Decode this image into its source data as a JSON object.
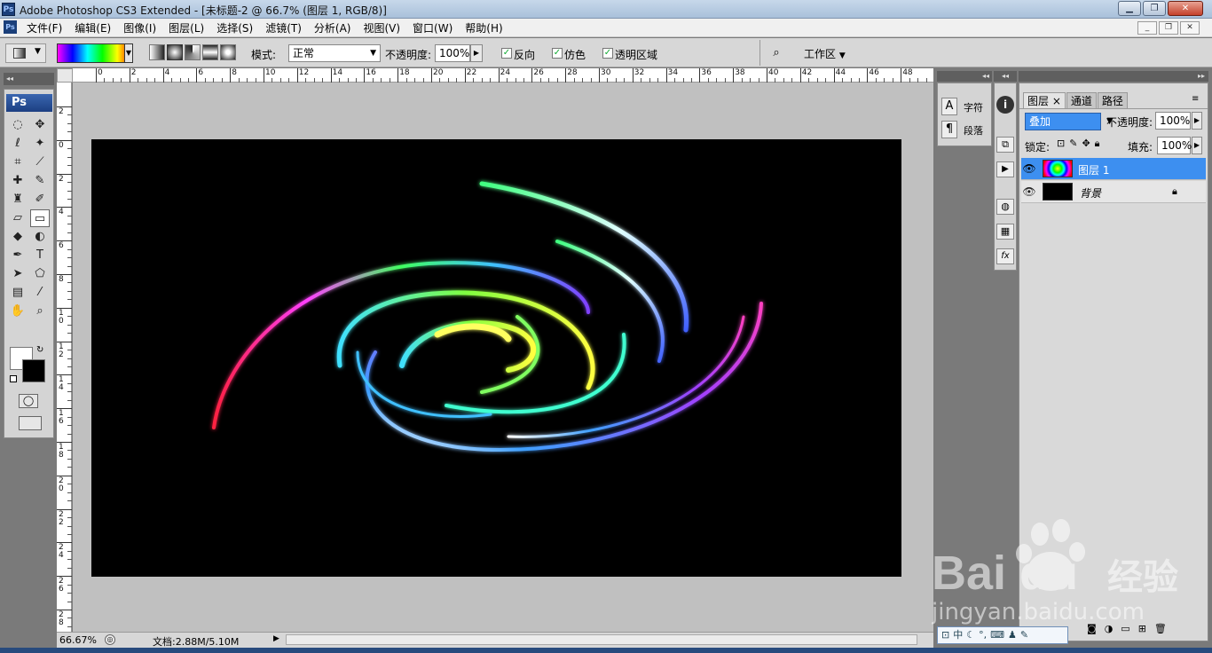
{
  "window": {
    "title": "Adobe Photoshop CS3 Extended - [未标题-2 @ 66.7% (图层 1, RGB/8)]",
    "app_icon": "Ps",
    "controls": [
      "minimize-icon",
      "maximize-icon",
      "close-icon"
    ]
  },
  "menubar": {
    "items": [
      "文件(F)",
      "编辑(E)",
      "图像(I)",
      "图层(L)",
      "选择(S)",
      "滤镜(T)",
      "分析(A)",
      "视图(V)",
      "窗口(W)",
      "帮助(H)"
    ]
  },
  "options": {
    "mode_label": "模式:",
    "mode_value": "正常",
    "opacity_label": "不透明度:",
    "opacity_value": "100%",
    "reverse_label": "反向",
    "dither_label": "仿色",
    "transparency_label": "透明区域",
    "workspace_label": "工作区"
  },
  "toolbox": {
    "logo": "Ps"
  },
  "rulers": {
    "top_ticks": [
      "0",
      "2",
      "4",
      "6",
      "8",
      "10",
      "12",
      "14",
      "16",
      "18",
      "20",
      "22",
      "24",
      "26",
      "28",
      "30",
      "32",
      "34",
      "36",
      "38",
      "40",
      "42",
      "44",
      "46",
      "48"
    ],
    "left_ticks": [
      "2",
      "0",
      "2",
      "4",
      "6",
      "8",
      "10",
      "12",
      "14",
      "16",
      "18",
      "20",
      "22",
      "24",
      "26",
      "28"
    ]
  },
  "status": {
    "zoom": "66.67%",
    "doc_info": "文档:2.88M/5.10M"
  },
  "mini_panel": {
    "char_label": "字符",
    "para_label": "段落"
  },
  "layers_panel": {
    "tabs": [
      "图层",
      "通道",
      "路径"
    ],
    "blend_mode": "叠加",
    "opacity_label": "不透明度:",
    "opacity_value": "100%",
    "lock_label": "锁定:",
    "fill_label": "填充:",
    "fill_value": "100%",
    "layers": [
      {
        "name": "图层 1",
        "selected": true
      },
      {
        "name": "背景",
        "selected": false
      }
    ]
  },
  "ime_bar": {
    "label": "中"
  },
  "watermark": {
    "brand": "Bai du",
    "brand_cn": "经验",
    "url": "jingyan.baidu.com"
  },
  "colors": {
    "selection_blue": "#3d8ff0",
    "panel_gray": "#d4d4d4",
    "canvas_bg": "#c0c0c0"
  }
}
